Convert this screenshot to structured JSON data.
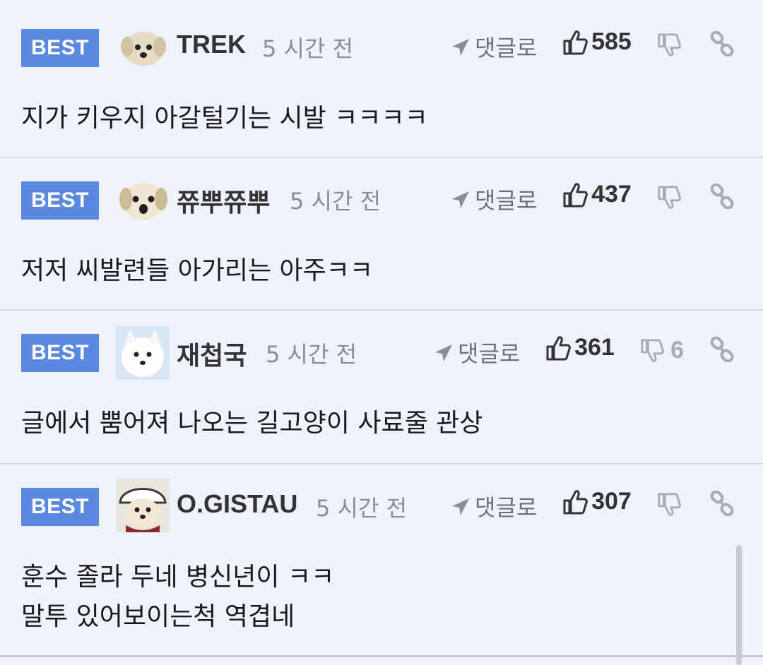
{
  "comments": [
    {
      "badge": "BEST",
      "username": "TREK",
      "time": "5 시간 전",
      "reply_label": "댓글로",
      "likes": "585",
      "dislikes": "",
      "lines": [
        "지가 키우지 아갈털기는 시발 ㅋㅋㅋㅋ"
      ],
      "avatar": "puppy-avatar"
    },
    {
      "badge": "BEST",
      "username": "쮸뿌쮸뿌",
      "time": "5 시간 전",
      "reply_label": "댓글로",
      "likes": "437",
      "dislikes": "",
      "lines": [
        "저저 씨발련들 아가리는 아주ㅋㅋ"
      ],
      "avatar": "puppy-avatar"
    },
    {
      "badge": "BEST",
      "username": "재첩국",
      "time": "5 시간 전",
      "reply_label": "댓글로",
      "likes": "361",
      "dislikes": "6",
      "lines": [
        "글에서 뿜어져 나오는 길고양이 사료줄 관상"
      ],
      "avatar": "white-dog-avatar"
    },
    {
      "badge": "BEST",
      "username": "O.GISTAU",
      "time": "5 시간 전",
      "reply_label": "댓글로",
      "likes": "307",
      "dislikes": "",
      "lines": [
        "훈수 졸라 두네 병신년이 ㅋㅋ",
        "말투 있어보이는척 역겹네"
      ],
      "avatar": "puppy-hat-avatar"
    }
  ],
  "colors": {
    "background": "#eef2fb",
    "badge": "#5b89e0",
    "divider": "#d6d9e0"
  }
}
